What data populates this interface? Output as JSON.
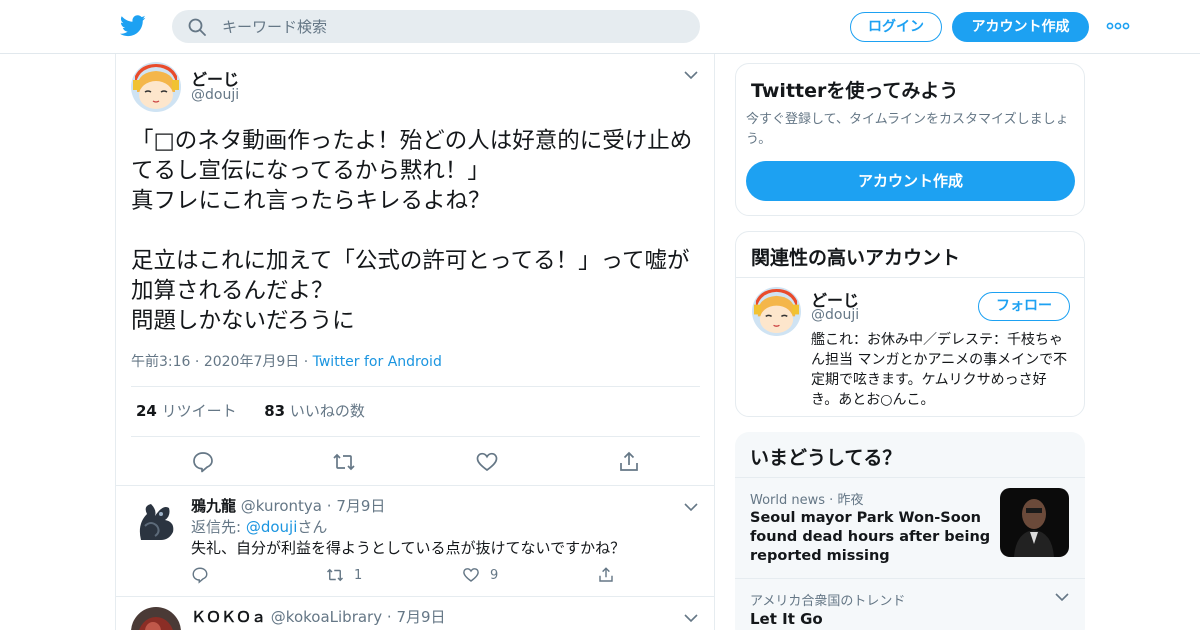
{
  "colors": {
    "accent": "#1da1f2",
    "link": "#1b95e0",
    "text": "#14171a",
    "muted": "#657786",
    "border": "#e6ecf0"
  },
  "header": {
    "logo_icon": "twitter-bird-icon",
    "search_placeholder": "キーワード検索",
    "login_label": "ログイン",
    "signup_label": "アカウント作成",
    "more_icon": "more-dots-icon"
  },
  "tweet": {
    "name": "どーじ",
    "handle": "@douji",
    "text": "「□のネタ動画作ったよ！殆どの人は好意的に受け止めてるし宣伝になってるから黙れ！」\n真フレにこれ言ったらキレるよね？\n\n足立はこれに加えて「公式の許可とってる！」って嘘が加算されるんだよ？\n問題しかないだろうに",
    "time": "午前3:16",
    "date": "2020年7月9日",
    "client": "Twitter for Android",
    "retweets": "24",
    "retweets_label": "リツイート",
    "likes": "83",
    "likes_label": "いいねの数"
  },
  "replies": [
    {
      "name": "鴉九龍",
      "handle": "@kurontya",
      "date": "7月9日",
      "reply_prefix": "返信先: ",
      "reply_to": "@douji",
      "reply_suffix": "さん",
      "text": "失礼、自分が利益を得ようとしている点が抜けてないですかね？",
      "retweets": "1",
      "likes": "9"
    },
    {
      "name": "ＫＯＫＯａ",
      "handle": "@kokoaLibrary",
      "date": "7月9日"
    }
  ],
  "signup_card": {
    "title": "Twitterを使ってみよう",
    "desc": "今すぐ登録して、タイムラインをカスタマイズしましょう。",
    "button": "アカウント作成"
  },
  "related": {
    "title": "関連性の高いアカウント",
    "name": "どーじ",
    "handle": "@douji",
    "follow": "フォロー",
    "bio": "艦これ：お休み中／デレステ：千枝ちゃん担当 マンガとかアニメの事メインで不定期で呟きます。ケムリクサめっさ好き。あとお○んこ。"
  },
  "trends": {
    "title": "いまどうしてる？",
    "news_source": "World news",
    "news_time": "昨夜",
    "news_title": "Seoul mayor Park Won-Soon found dead hours after being reported missing",
    "trend_meta": "アメリカ合衆国のトレンド",
    "trend_name": "Let It Go"
  }
}
